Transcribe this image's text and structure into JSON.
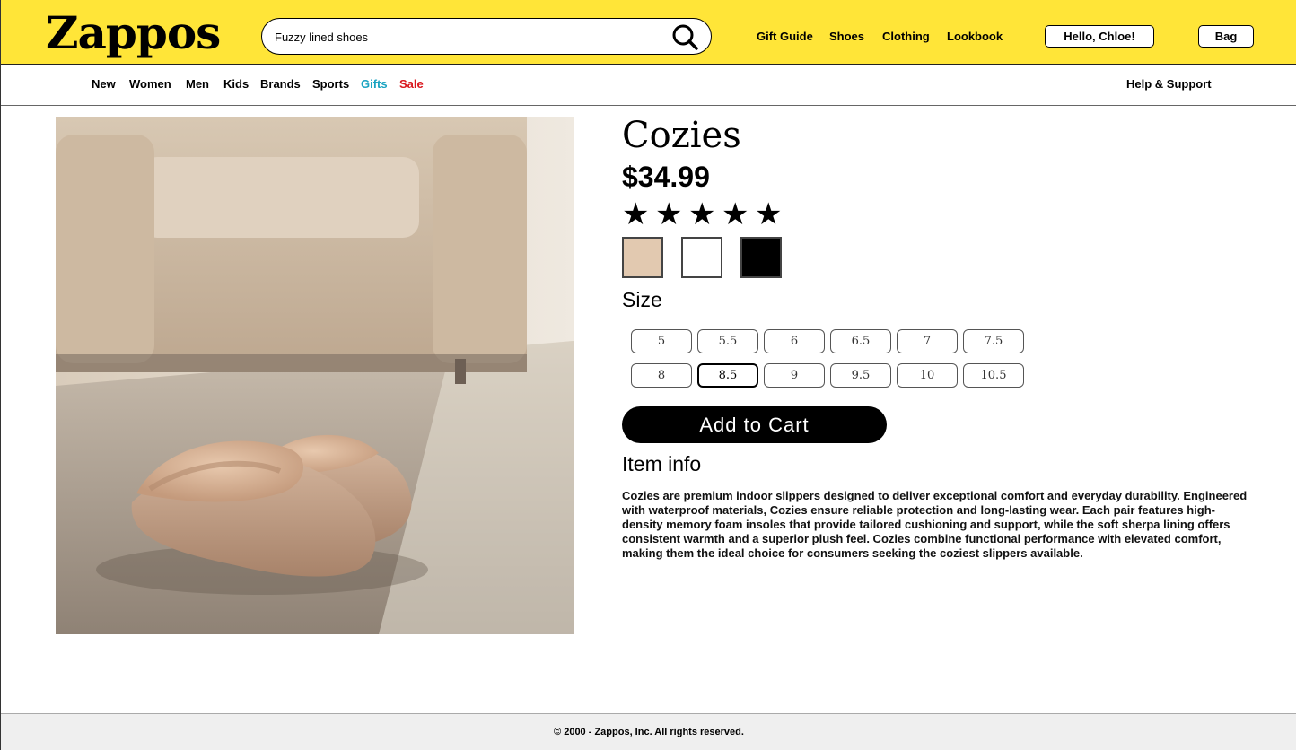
{
  "header": {
    "logo": "Zappos",
    "search": {
      "value": "Fuzzy lined shoes",
      "placeholder": ""
    },
    "nav": [
      "Gift Guide",
      "Shoes",
      "Clothing",
      "Lookbook"
    ],
    "greeting_button": "Hello, Chloe!",
    "bag_button": "Bag"
  },
  "subnav": {
    "items": [
      {
        "label": "New",
        "color": "#000000"
      },
      {
        "label": "Women",
        "color": "#000000"
      },
      {
        "label": "Men",
        "color": "#000000"
      },
      {
        "label": "Kids",
        "color": "#000000"
      },
      {
        "label": "Brands",
        "color": "#000000"
      },
      {
        "label": "Sports",
        "color": "#000000"
      },
      {
        "label": "Gifts",
        "color": "#1aa3c1"
      },
      {
        "label": "Sale",
        "color": "#d9161c"
      }
    ],
    "help": "Help & Support"
  },
  "product": {
    "name": "Cozies",
    "price": "$34.99",
    "rating": {
      "value": 5,
      "max": 5
    },
    "colors": [
      "#e2c9b0",
      "#ffffff",
      "#000000"
    ],
    "size_label": "Size",
    "sizes": [
      "5",
      "5.5",
      "6",
      "6.5",
      "7",
      "7.5",
      "8",
      "8.5",
      "9",
      "9.5",
      "10",
      "10.5"
    ],
    "selected_size": "8.5",
    "add_to_cart": "Add to Cart",
    "info_heading": "Item info",
    "description": "Cozies are premium indoor slippers designed to deliver exceptional comfort and everyday durability. Engineered with waterproof materials, Cozies ensure reliable protection and long-lasting wear. Each pair features high-density memory foam insoles that provide tailored cushioning and support, while the soft sherpa lining offers consistent warmth and a superior plush feel. Cozies combine functional performance with elevated comfort, making them the ideal choice for consumers seeking the coziest slippers available."
  },
  "footer": {
    "copyright": "© 2000 - Zappos, Inc. All rights reserved."
  },
  "colors": {
    "header_bg": "#ffe538",
    "footer_bg": "#efefef",
    "button_dark": "#000000"
  }
}
